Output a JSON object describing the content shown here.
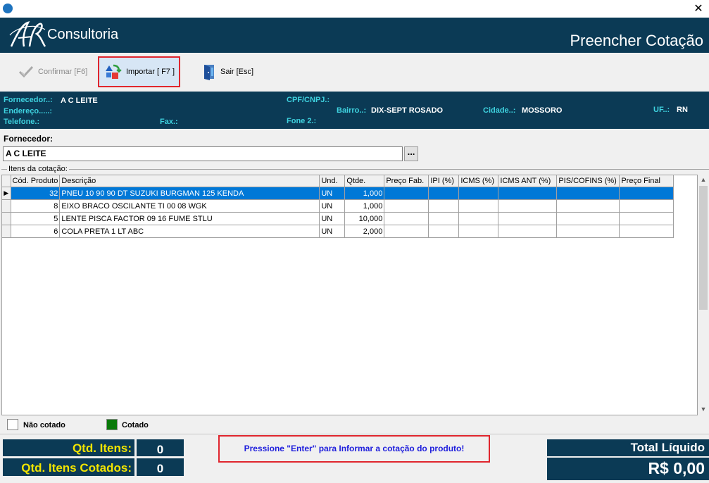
{
  "window": {
    "close_glyph": "✕"
  },
  "header": {
    "brand": "Consultoria",
    "title": "Preencher Cotação"
  },
  "toolbar": {
    "confirm_label": "Confirmar [F6]",
    "import_label": "Importar  [ F7 ]",
    "exit_label": "Sair [Esc]"
  },
  "supplier_info": {
    "fornecedor_label": "Fornecedor..:",
    "fornecedor_value": "A C LEITE",
    "cpf_label": "CPF/CNPJ.:",
    "cpf_value": "",
    "endereco_label": "Endereço.....:",
    "endereco_value": "",
    "bairro_label": "Bairro..:",
    "bairro_value": "DIX-SEPT ROSADO",
    "cidade_label": "Cidade..:",
    "cidade_value": "MOSSORO",
    "uf_label": "UF..:",
    "uf_value": "RN",
    "telefone_label": "Telefone.:",
    "fax_label": "Fax.:",
    "fone2_label": "Fone 2.:"
  },
  "supplier_field": {
    "label": "Fornecedor:",
    "value": "A C LEITE",
    "lookup": "..."
  },
  "items": {
    "group_label": "Itens da cotação:",
    "columns": [
      "Cód. Produto",
      "Descrição",
      "Und.",
      "Qtde.",
      "Preço Fab.",
      "IPI (%)",
      "ICMS (%)",
      "ICMS ANT (%)",
      "PIS/COFINS (%)",
      "Preço Final"
    ],
    "rows": [
      {
        "codigo": "32",
        "descricao": "PNEU 10 90 90 DT  SUZUKI BURGMAN 125 KENDA",
        "und": "UN",
        "qtde": "1,000"
      },
      {
        "codigo": "8",
        "descricao": "EIXO BRACO OSCILANTE TI 00 08 WGK",
        "und": "UN",
        "qtde": "1,000"
      },
      {
        "codigo": "5",
        "descricao": "LENTE PISCA FACTOR 09 16 FUME STLU",
        "und": "UN",
        "qtde": "10,000"
      },
      {
        "codigo": "6",
        "descricao": "COLA PRETA 1 LT ABC",
        "und": "UN",
        "qtde": "2,000"
      }
    ]
  },
  "legend": {
    "not_quoted": "Não cotado",
    "quoted": "Cotado",
    "quoted_color": "#0a7a0a"
  },
  "footer": {
    "qtd_itens_label": "Qtd. Itens:",
    "qtd_itens_value": "0",
    "qtd_cotados_label": "Qtd. Itens Cotados:",
    "qtd_cotados_value": "0",
    "hint": "Pressione \"Enter\" para Informar a cotação do produto!",
    "total_label": "Total Líquido",
    "total_value": "R$ 0,00"
  },
  "colors": {
    "navy": "#0b3a55",
    "cyan_label": "#3fd3e0",
    "yellow": "#f1e400",
    "selection": "#0078d7",
    "highlight_border": "#e0262e"
  }
}
